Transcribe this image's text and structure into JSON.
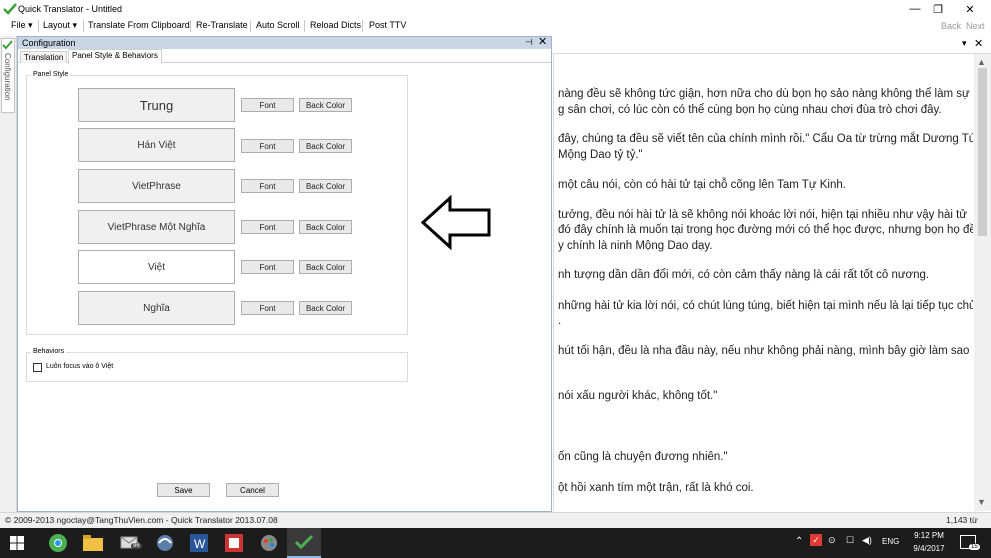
{
  "window": {
    "title": "Quick Translator - Untitled",
    "minimize_glyph": "—",
    "restore_glyph": "❐",
    "close_glyph": "✕"
  },
  "menu": {
    "items": [
      "File ▾",
      "Layout ▾",
      "Translate From Clipboard",
      "Re-Translate",
      "Auto Scroll",
      "Reload Dicts",
      "Post TTV"
    ],
    "back": "Back",
    "next": "Next"
  },
  "sidebar": {
    "tab_label": "Configuration"
  },
  "config": {
    "title": "Configuration",
    "pin_glyph": "⊣",
    "close_glyph": "✕",
    "tabs": [
      "Translation",
      "Panel Style & Behaviors"
    ],
    "panel_style_label": "Panel Style",
    "rows": [
      {
        "label": "Trung",
        "font": "Font",
        "back_color": "Back Color"
      },
      {
        "label": "Hán Việt",
        "font": "Font",
        "back_color": "Back Color"
      },
      {
        "label": "VietPhrase",
        "font": "Font",
        "back_color": "Back Color"
      },
      {
        "label": "VietPhrase Một Nghĩa",
        "font": "Font",
        "back_color": "Back Color"
      },
      {
        "label": "Việt",
        "font": "Font",
        "back_color": "Back Color"
      },
      {
        "label": "Nghĩa",
        "font": "Font",
        "back_color": "Back Color"
      }
    ],
    "behaviors_label": "Behaviors",
    "focus_checkbox_label": "Luôn focus vào ô Việt",
    "focus_checked": false,
    "save": "Save",
    "cancel": "Cancel"
  },
  "right_panel": {
    "chevron_glyph": "▾",
    "close_glyph": "✕",
    "lines": [
      "nàng đều sẽ không tức giận, hơn nữa cho dù bọn họ sảo nàng không thể làm sự",
      "g sân chơi, có lúc còn có thể cùng bọn họ cùng nhau chơi đùa trò chơi đây.",
      "đây, chúng ta đều sẽ viết tên của chính mình rồi.\" Cẩu Oa từ trừng mắt Dương Tú",
      "Mộng Dao tỷ tỷ.\"",
      "một câu nói, còn có hài tử tại chỗ cõng lên Tam Tự Kinh.",
      "tưởng, đều nói hài tử là sẽ không nói khoác lời nói, hiện tại nhiều như vậy hài tử",
      "đó đây chính là muốn tại trong học đường mới có thể học được, nhưng bọn họ đều",
      "y chính là ninh Mộng Dao dạy.",
      "nh tượng dần dần đổi mới, có còn cảm thấy nàng là cái rất tốt cô nương.",
      "những hài tử kia lời nói, có chút lúng túng, biết hiện tại mình nếu là lại tiếp tục chửi",
      ".",
      "hút tối hận, đều là nha đầu này, nếu như không phải nàng, mình bây giờ làm sao sẽ",
      "nói xấu người khác, không tốt.\"",
      "ốn cũng là chuyện đương nhiên.\"",
      "ột hồi xanh tím một trận, rất là khó coi."
    ]
  },
  "status": {
    "left": "© 2009-2013 ngoctay@TangThuVien.com - Quick Translator 2013.07.08",
    "right": "1,143 từ"
  },
  "taskbar": {
    "badge_96": "96",
    "tray_lang": "ENG",
    "time": "9:12 PM",
    "date": "9/4/2017",
    "notif_count": "15",
    "tray_up": "⌃"
  },
  "colors": {
    "accent_check": "#3ca33c",
    "header_blue": "#c8d6e6"
  }
}
